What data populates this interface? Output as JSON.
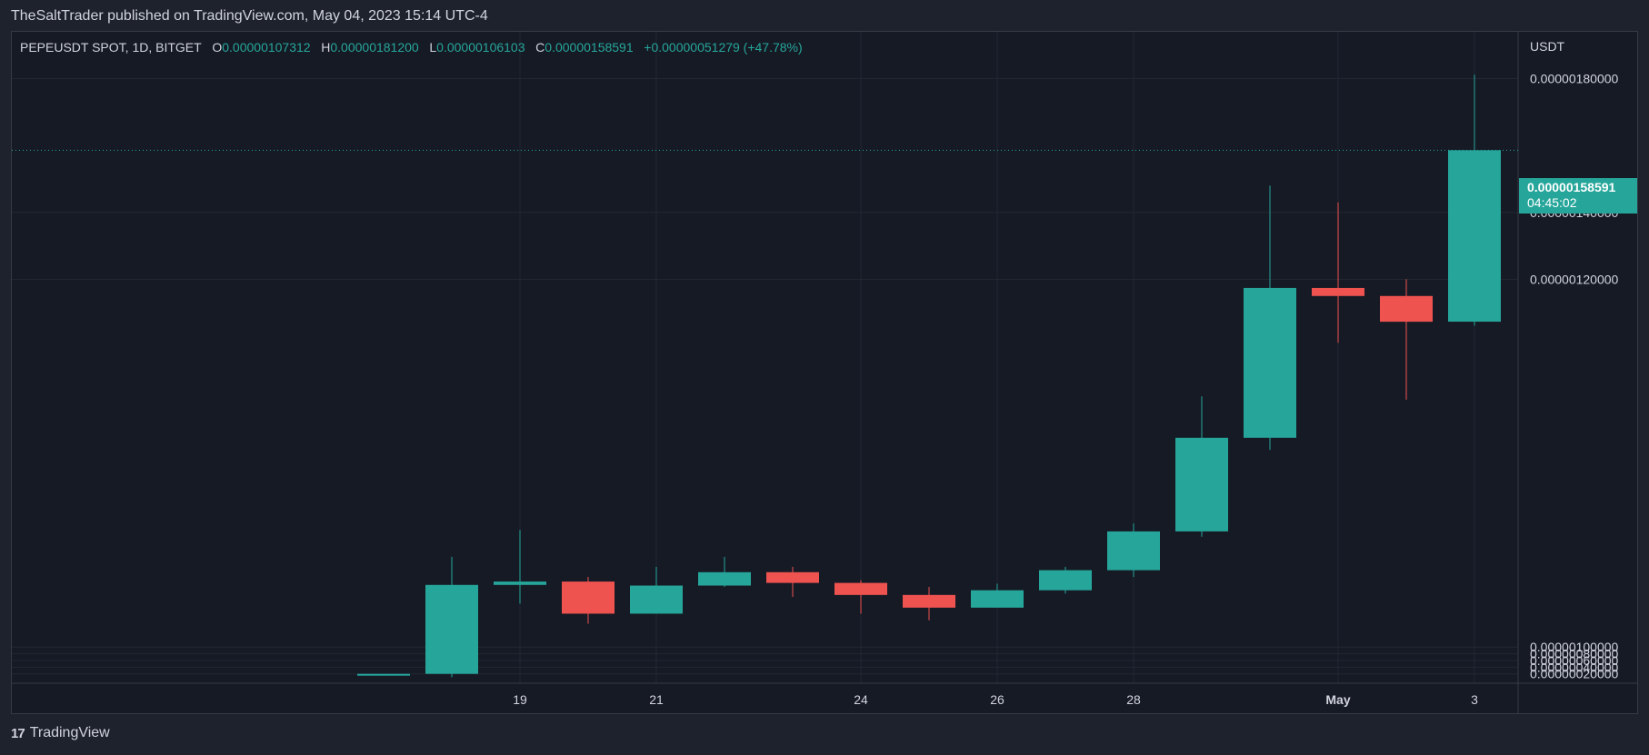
{
  "header": {
    "publish_text": "TheSaltTrader published on TradingView.com, May 04, 2023 15:14 UTC-4"
  },
  "legend": {
    "symbol": "PEPEUSDT SPOT, 1D, BITGET",
    "open_label": "O",
    "open": "0.00000107312",
    "high_label": "H",
    "high": "0.00000181200",
    "low_label": "L",
    "low": "0.00000106103",
    "close_label": "C",
    "close": "0.00000158591",
    "change": "+0.00000051279 (+47.78%)"
  },
  "price_scale": {
    "unit": "USDT",
    "last_price": "0.00000158591",
    "countdown": "04:45:02"
  },
  "footer": {
    "logo_mark": "17",
    "logo_text": "TradingView"
  },
  "colors": {
    "up": "#26a69a",
    "down": "#ef5350",
    "background": "#161a25",
    "grid": "#232733",
    "text": "#d1d4dc"
  },
  "chart_data": {
    "type": "candlestick",
    "title": "PEPEUSDT SPOT, 1D, BITGET",
    "ylim": [
      -8e-09,
      1.94e-06
    ],
    "y_ticks": [
      {
        "value": 2e-08,
        "label": "0.00000020000"
      },
      {
        "value": 4e-08,
        "label": "0.00000040000"
      },
      {
        "value": 6e-08,
        "label": "0.00000060000"
      },
      {
        "value": 8e-08,
        "label": "0.00000080000"
      },
      {
        "value": 1e-07,
        "label": "0.00000100000"
      },
      {
        "value": 1.2e-06,
        "label": "0.00000120000"
      },
      {
        "value": 1.4e-06,
        "label": "0.00000140000"
      },
      {
        "value": 1.8e-06,
        "label": "0.00000180000"
      }
    ],
    "x_ticks": [
      {
        "index": 1,
        "label": "19",
        "bold": false
      },
      {
        "index": 3,
        "label": "21",
        "bold": false
      },
      {
        "index": 6,
        "label": "24",
        "bold": false
      },
      {
        "index": 8,
        "label": "26",
        "bold": false
      },
      {
        "index": 10,
        "label": "28",
        "bold": false
      },
      {
        "index": 13,
        "label": "May",
        "bold": true
      },
      {
        "index": 15,
        "label": "3",
        "bold": false
      }
    ],
    "candles": [
      {
        "date": "Apr 18",
        "open": 1.8e-08,
        "high": 2e-08,
        "low": 1.6e-08,
        "close": 2e-08
      },
      {
        "date": "Apr 19",
        "open": 2e-08,
        "high": 3.7e-07,
        "low": 1e-08,
        "close": 2.86e-07
      },
      {
        "date": "Apr 20",
        "open": 2.86e-07,
        "high": 4.5e-07,
        "low": 2.3e-07,
        "close": 2.96e-07
      },
      {
        "date": "Apr 21",
        "open": 2.96e-07,
        "high": 3.1e-07,
        "low": 1.7e-07,
        "close": 2e-07
      },
      {
        "date": "Apr 22",
        "open": 2e-07,
        "high": 3.4e-07,
        "low": 2e-07,
        "close": 2.84e-07
      },
      {
        "date": "Apr 23",
        "open": 2.84e-07,
        "high": 3.7e-07,
        "low": 2.8e-07,
        "close": 3.24e-07
      },
      {
        "date": "Apr 24",
        "open": 3.24e-07,
        "high": 3.4e-07,
        "low": 2.5e-07,
        "close": 2.92e-07
      },
      {
        "date": "Apr 25",
        "open": 2.92e-07,
        "high": 3e-07,
        "low": 2e-07,
        "close": 2.56e-07
      },
      {
        "date": "Apr 26",
        "open": 2.56e-07,
        "high": 2.8e-07,
        "low": 1.8e-07,
        "close": 2.18e-07
      },
      {
        "date": "Apr 27",
        "open": 2.18e-07,
        "high": 2.9e-07,
        "low": 2.18e-07,
        "close": 2.7e-07
      },
      {
        "date": "Apr 28",
        "open": 2.7e-07,
        "high": 3.4e-07,
        "low": 2.6e-07,
        "close": 3.3e-07
      },
      {
        "date": "Apr 29",
        "open": 3.3e-07,
        "high": 4.7e-07,
        "low": 3.1e-07,
        "close": 4.46e-07
      },
      {
        "date": "Apr 30",
        "open": 4.46e-07,
        "high": 8.5e-07,
        "low": 4.3e-07,
        "close": 7.26e-07
      },
      {
        "date": "May 1",
        "open": 7.26e-07,
        "high": 1.48e-06,
        "low": 6.9e-07,
        "close": 1.174e-06
      },
      {
        "date": "May 2",
        "open": 1.174e-06,
        "high": 1.43e-06,
        "low": 1.01e-06,
        "close": 1.15e-06
      },
      {
        "date": "May 3",
        "open": 1.15e-06,
        "high": 1.2e-06,
        "low": 8.4e-07,
        "close": 1.073e-06
      },
      {
        "date": "May 4",
        "open": 1.07312e-06,
        "high": 1.812e-06,
        "low": 1.06103e-06,
        "close": 1.58591e-06
      }
    ],
    "last_price": 1.58591e-06
  }
}
